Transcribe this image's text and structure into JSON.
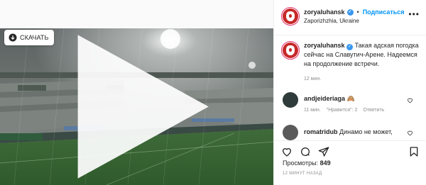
{
  "download": {
    "label": "СКАЧАТЬ"
  },
  "header": {
    "username": "zoryaluhansk",
    "separator": "•",
    "follow_label": "Подписаться",
    "location": "Zaporizhzhia, Ukraine",
    "more": "•••"
  },
  "caption": {
    "username": "zoryaluhansk",
    "text": "Такая адская погодка сейчас на Славутич-Арене. Надеемся на продолжение встречи.",
    "time": "12 мин."
  },
  "comments": [
    {
      "username": "andjeideriaga",
      "text": "🙈",
      "time": "11 мин.",
      "likes": "\"Нравится\": 2",
      "reply": "Ответить"
    },
    {
      "username": "romatridub",
      "text": "Динамо не может,",
      "time": "",
      "likes": "",
      "reply": ""
    }
  ],
  "stats": {
    "views_label": "Просмотры:",
    "views_value": "849",
    "post_time": "12 МИНУТ НАЗАД"
  },
  "colors": {
    "accent": "#0095f6",
    "verified": "#3897f0",
    "brand_red": "#c62828"
  }
}
